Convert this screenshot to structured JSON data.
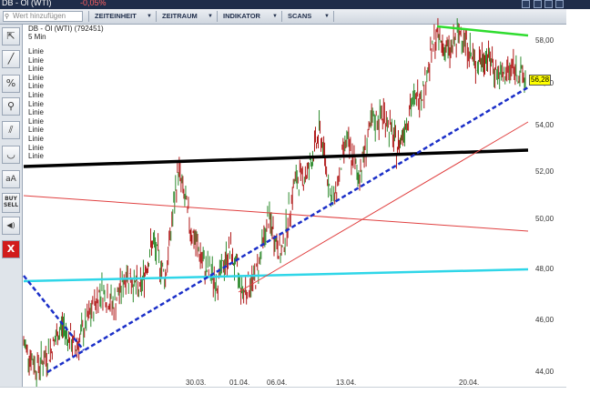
{
  "titlebar": {
    "title": "DB - Öl (WTI)",
    "change": "-0,05%"
  },
  "search": {
    "placeholder": "Wert hinzufügen"
  },
  "menus": [
    {
      "label": "ZEITEINHEIT"
    },
    {
      "label": "ZEITRAUM"
    },
    {
      "label": "INDIKATOR"
    },
    {
      "label": "SCANS"
    }
  ],
  "toolbar": {
    "tools": [
      {
        "name": "cursor-icon",
        "glyph": "⇱"
      },
      {
        "name": "trendline-icon",
        "glyph": "╱"
      },
      {
        "name": "percent-icon",
        "glyph": "%"
      },
      {
        "name": "zoom-icon",
        "glyph": "⚲"
      },
      {
        "name": "parallel-lines-icon",
        "glyph": "⫽"
      },
      {
        "name": "curve-icon",
        "glyph": "◡"
      },
      {
        "name": "text-tool-icon",
        "glyph": "aA"
      },
      {
        "name": "buy-sell-icon",
        "glyph": "BUY SELL"
      },
      {
        "name": "sound-icon",
        "glyph": "◀)"
      },
      {
        "name": "close-icon",
        "glyph": "X"
      }
    ]
  },
  "chart_header": {
    "instrument": "DB - Öl (WTI) (792451)",
    "interval": "5 Min"
  },
  "drawings_list": [
    "Linie",
    "Linie",
    "Linie",
    "Linie",
    "Linie",
    "Linie",
    "Linie",
    "Linie",
    "Linie",
    "Linie",
    "Linie",
    "Linie",
    "Linie"
  ],
  "current_price": "56,28",
  "chart_data": {
    "type": "line",
    "title": "DB - Öl (WTI) (792451)",
    "interval": "5 Min",
    "x_ticks": [
      "30.03.",
      "01.04.",
      "06.04.",
      "13.04.",
      "20.04."
    ],
    "y_ticks": [
      "44,00",
      "46,00",
      "48,00",
      "50,00",
      "52,00",
      "54,00",
      "56,00",
      "58,00"
    ],
    "ylim": [
      44,
      58
    ],
    "last_price": 56.28,
    "price_path": [
      45.2,
      44.2,
      44.8,
      46.0,
      45.0,
      46.2,
      47.5,
      46.8,
      48.2,
      47.4,
      49.5,
      48.0,
      52.6,
      50.0,
      48.5,
      47.8,
      49.2,
      47.4,
      48.0,
      50.5,
      48.9,
      52.0,
      52.4,
      54.2,
      51.0,
      53.8,
      52.3,
      54.5,
      54.9,
      53.4,
      55.2,
      56.0,
      58.2,
      57.5,
      58.4,
      57.0,
      57.4,
      56.4,
      56.9,
      56.28
    ],
    "colors": {
      "candles_up": "#2e8b2e",
      "candles_down": "#b01818",
      "support_line": "#000000",
      "blue_trend": "#1b2fc8",
      "red_trend": "#e04040",
      "cyan_line": "#2fd6e8",
      "green_line": "#2fdc2f"
    }
  },
  "x_labels": [
    "30.03.",
    "01.04.",
    "06.04.",
    "13.04.",
    "20.04."
  ],
  "y_labels": [
    "58,00",
    "56,00",
    "54,00",
    "52,00",
    "50,00",
    "48,00",
    "46,00",
    "44,00"
  ]
}
